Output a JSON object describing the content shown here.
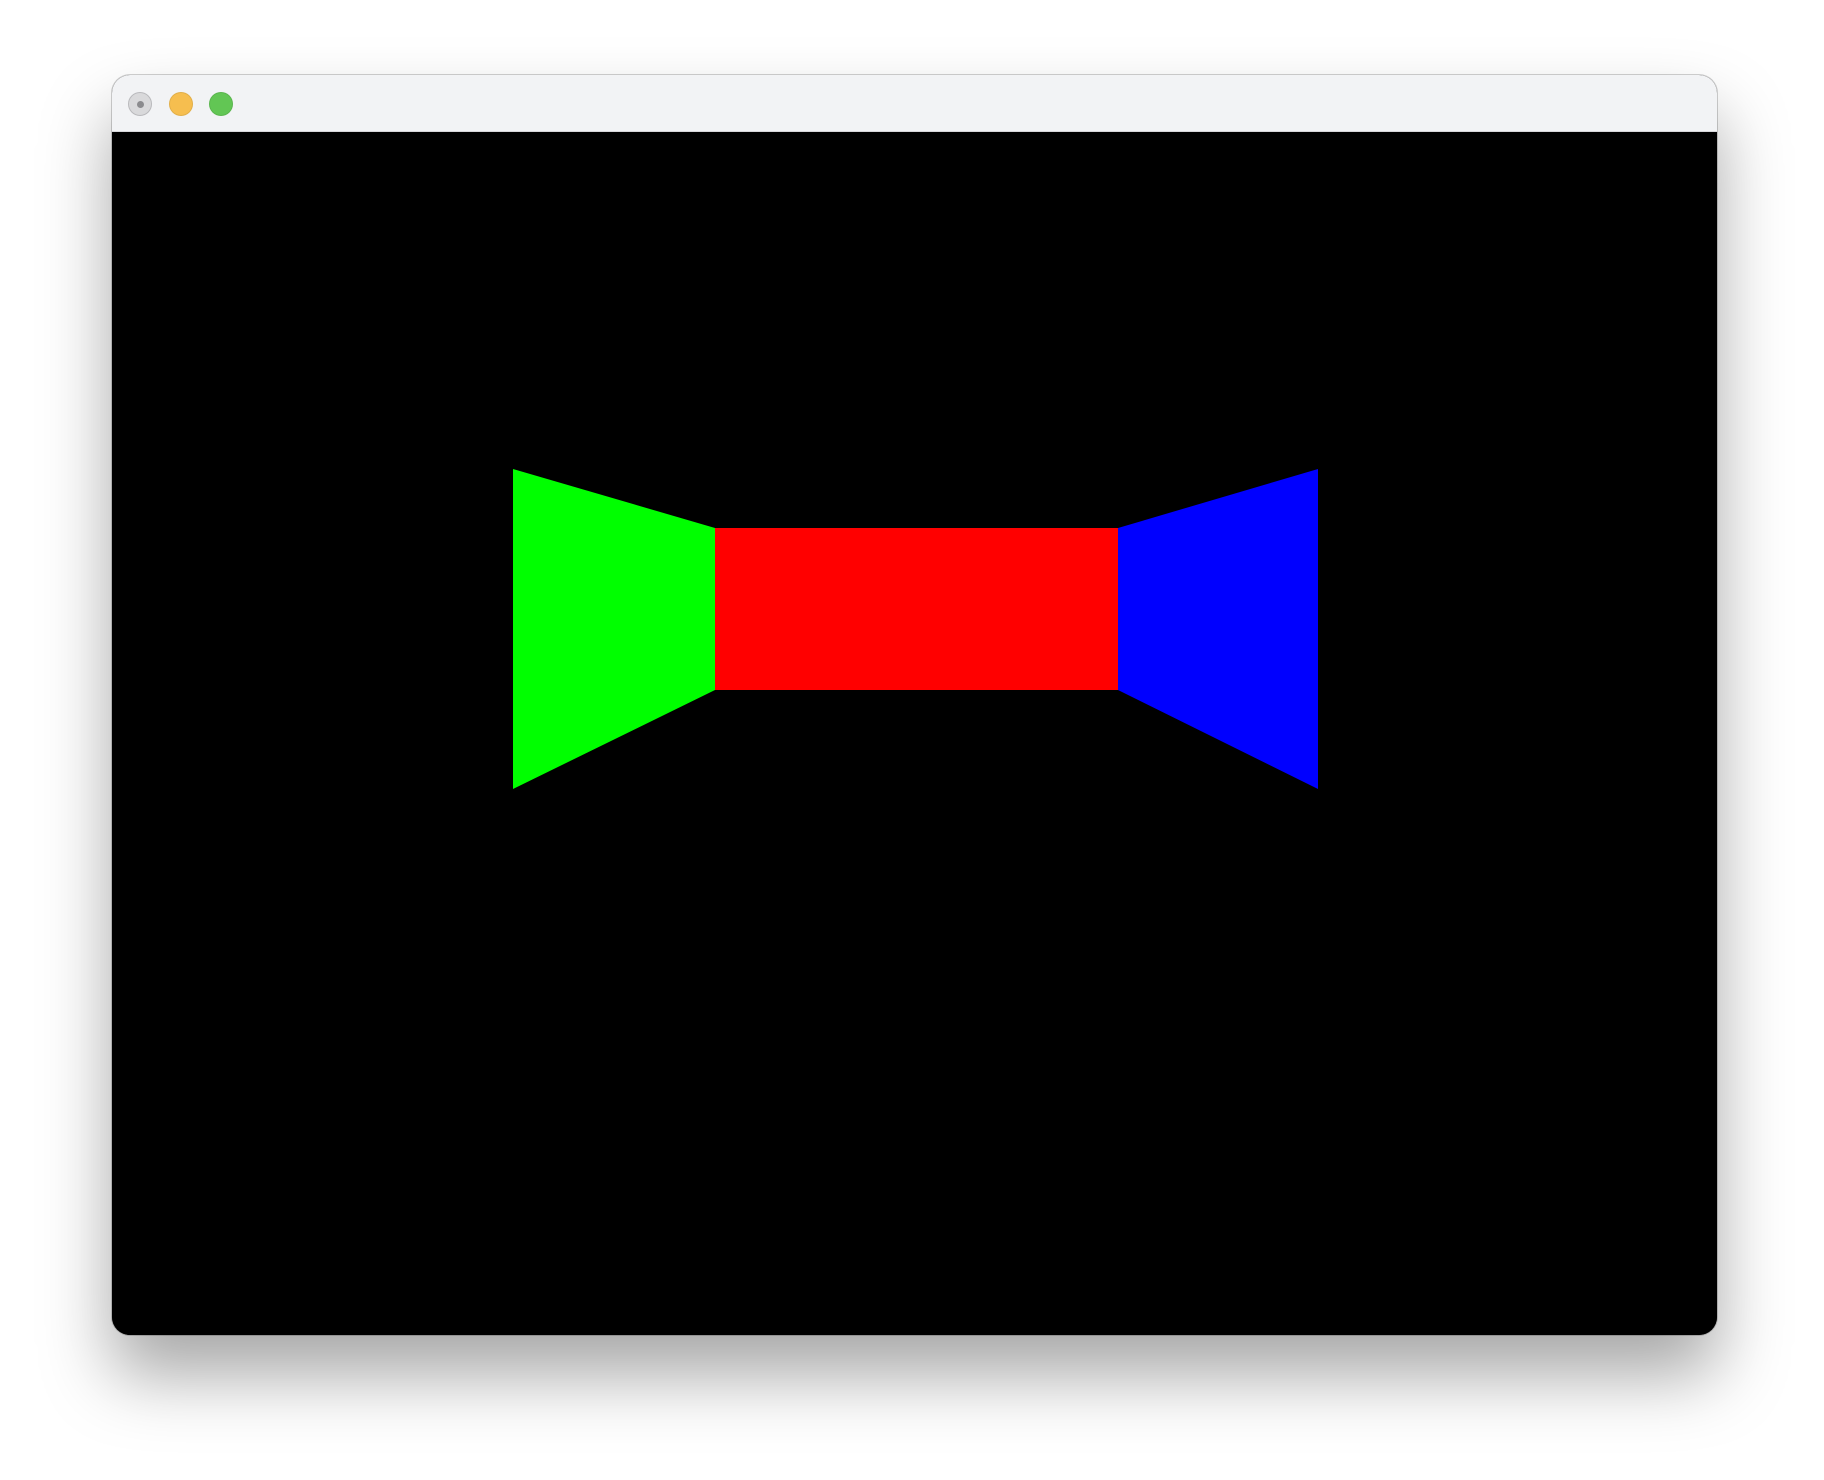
{
  "window": {
    "controls": {
      "close_color": "#d9d9db",
      "minimize_color": "#f6be4f",
      "maximize_color": "#62c654"
    }
  },
  "canvas": {
    "background": "#000000",
    "panels": {
      "left_color": "#00ff00",
      "center_color": "#ff0000",
      "right_color": "#0000ff"
    }
  }
}
